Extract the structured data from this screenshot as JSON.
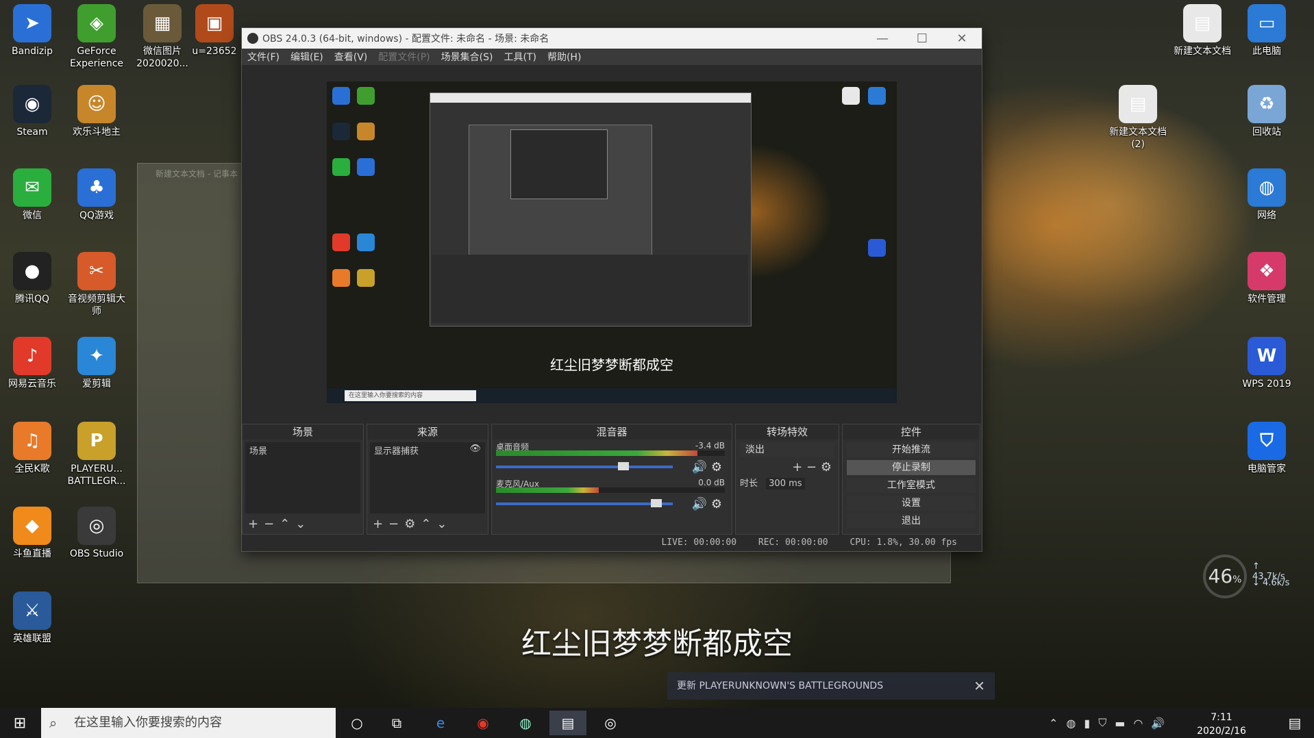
{
  "desktop": {
    "left_icons": [
      {
        "label": "Bandizip",
        "glyph": "➤",
        "color": "#2a6fd6"
      },
      {
        "label": "GeForce Experience",
        "glyph": "◈",
        "color": "#3f9e2e"
      },
      {
        "label": "微信图片 2020020...",
        "glyph": "▦",
        "color": "#6b5a3a"
      },
      {
        "label": "u=23652",
        "glyph": "▣",
        "color": "#b04a1a"
      },
      {
        "label": "Steam",
        "glyph": "◉",
        "color": "#1b2838"
      },
      {
        "label": "欢乐斗地主",
        "glyph": "☺",
        "color": "#c8862a"
      },
      {
        "label": "微信",
        "glyph": "✉",
        "color": "#2aae3e"
      },
      {
        "label": "QQ游戏",
        "glyph": "♣",
        "color": "#2a6fd6"
      },
      {
        "label": "腾讯QQ",
        "glyph": "●",
        "color": "#222"
      },
      {
        "label": "音视频剪辑大师",
        "glyph": "✂",
        "color": "#d65a2a"
      },
      {
        "label": "网易云音乐",
        "glyph": "♪",
        "color": "#e23a2a"
      },
      {
        "label": "爱剪辑",
        "glyph": "✦",
        "color": "#2a86d6"
      },
      {
        "label": "全民K歌",
        "glyph": "♫",
        "color": "#e87a2a"
      },
      {
        "label": "PLAYERU... BATTLEGR...",
        "glyph": "P",
        "color": "#c8a02a"
      },
      {
        "label": "斗鱼直播",
        "glyph": "◆",
        "color": "#f08a1a"
      },
      {
        "label": "OBS Studio",
        "glyph": "◎",
        "color": "#3a3a3a"
      },
      {
        "label": "英雄联盟",
        "glyph": "⚔",
        "color": "#2a5a9a"
      }
    ],
    "right_icons": [
      {
        "label": "新建文本文档",
        "glyph": "▤",
        "color": "#e8e8e8"
      },
      {
        "label": "此电脑",
        "glyph": "▭",
        "color": "#2a7ad6"
      },
      {
        "label": "新建文本文档 (2)",
        "glyph": "▤",
        "color": "#e8e8e8"
      },
      {
        "label": "回收站",
        "glyph": "♻",
        "color": "#7aa6d6"
      },
      {
        "label": "网络",
        "glyph": "◍",
        "color": "#2a7ad6"
      },
      {
        "label": "软件管理",
        "glyph": "❖",
        "color": "#d63a6a"
      },
      {
        "label": "WPS 2019",
        "glyph": "W",
        "color": "#2a5ad6"
      },
      {
        "label": "电脑管家",
        "glyph": "⛉",
        "color": "#1a6ae6"
      }
    ]
  },
  "ghost_title": "新建文本文档 - 记事本",
  "obs": {
    "title": "OBS 24.0.3 (64-bit, windows) - 配置文件: 未命名 - 场景: 未命名",
    "menu": [
      "文件(F)",
      "编辑(E)",
      "查看(V)",
      "配置文件(P)",
      "场景集合(S)",
      "工具(T)",
      "帮助(H)"
    ],
    "preview_subtitle": "红尘旧梦梦断都成空",
    "preview_search": "在这里输入你要搜索的内容",
    "docks": {
      "scenes": {
        "title": "场景",
        "items": [
          "场景"
        ]
      },
      "sources": {
        "title": "来源",
        "items": [
          "显示器捕获"
        ]
      },
      "mixer": {
        "title": "混音器",
        "tracks": [
          {
            "name": "桌面音频",
            "db": "-3.4 dB",
            "level": 0.88,
            "volume": 0.8
          },
          {
            "name": "麦克风/Aux",
            "db": "0.0 dB",
            "level": 0.45,
            "volume": 0.95
          }
        ]
      },
      "transitions": {
        "title": "转场特效",
        "selected": "淡出",
        "duration_label": "时长",
        "duration": "300 ms"
      },
      "controls": {
        "title": "控件",
        "buttons": [
          "开始推流",
          "停止录制",
          "工作室模式",
          "设置",
          "退出"
        ]
      }
    },
    "status": {
      "live": "LIVE: 00:00:00",
      "rec": "REC: 00:00:00",
      "cpu": "CPU: 1.8%, 30.00 fps"
    }
  },
  "subtitle": "红尘旧梦梦断都成空",
  "notification": {
    "text": "更新 PLAYERUNKNOWN'S BATTLEGROUNDS"
  },
  "net_widget": {
    "percent": "46",
    "unit": "%",
    "up": "43.7k/s",
    "down": "4.6k/s"
  },
  "taskbar": {
    "search_placeholder": "在这里输入你要搜索的内容",
    "time": "7:11",
    "date": "2020/2/16"
  }
}
